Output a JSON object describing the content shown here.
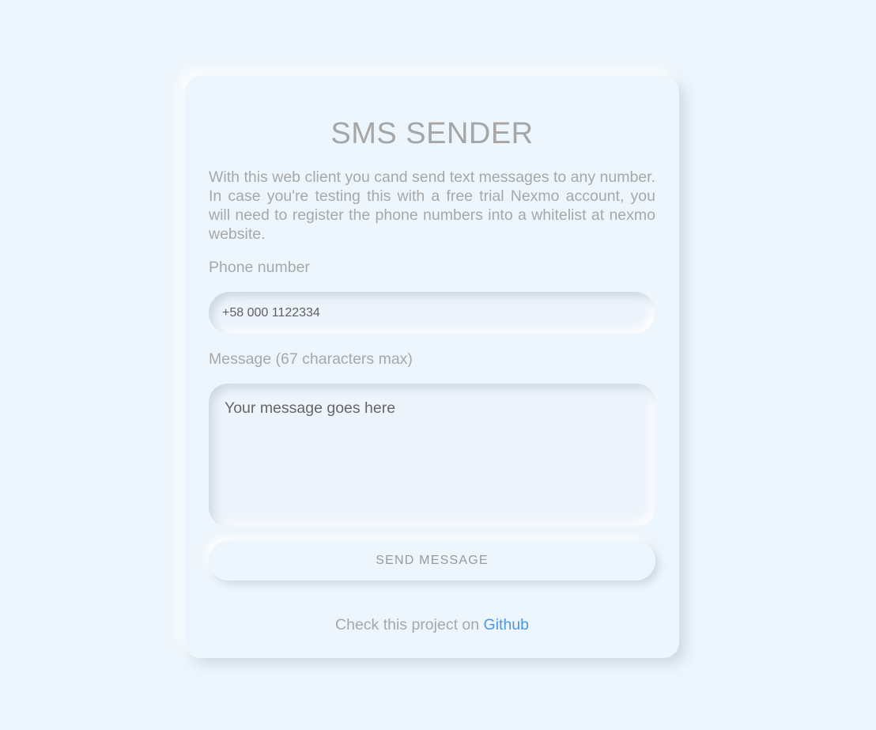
{
  "header": {
    "title": "SMS SENDER"
  },
  "intro": {
    "text": "With this web client you cand send text messages to any number. In case you're testing this with a free trial Nexmo account, you will need to register the phone numbers into a whitelist at nexmo website."
  },
  "form": {
    "phone_label": "Phone number",
    "phone_value": "+58 000 1122334",
    "message_label": "Message (67 characters max)",
    "message_placeholder": "Your message goes here",
    "send_label": "SEND MESSAGE"
  },
  "footer": {
    "prefix": "Check this project on ",
    "link_label": "Github"
  },
  "colors": {
    "background": "#edf6fc",
    "link": "#4a98e0",
    "text": "#a8a8a8"
  }
}
